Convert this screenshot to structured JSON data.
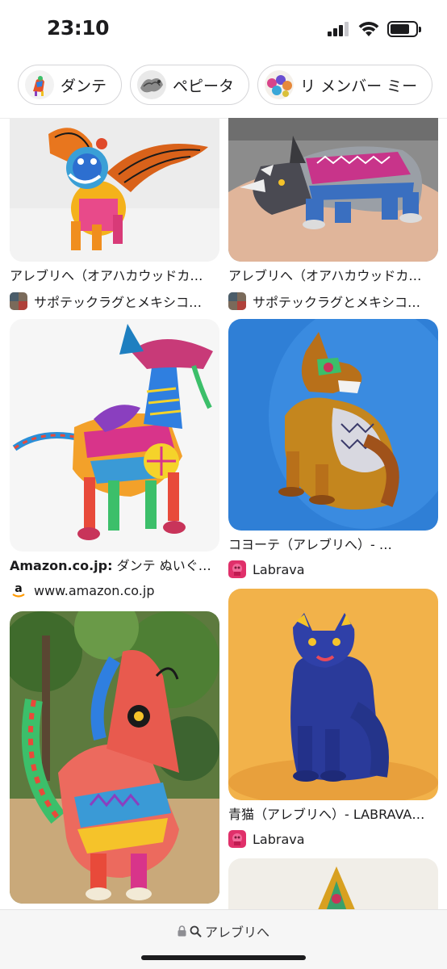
{
  "status": {
    "time": "23:10",
    "battery_level": 0.75
  },
  "chips": [
    {
      "label": "ダンテ",
      "thumb_icon": "dante-alebrije-thumb"
    },
    {
      "label": "ペピータ",
      "thumb_icon": "pepita-alebrije-thumb"
    },
    {
      "label": "リ メンバー ミー",
      "thumb_icon": "remember-me-thumb"
    }
  ],
  "results": {
    "left": [
      {
        "title": "アレブリへ（オアハカウッドカ…",
        "source": "サポテックラグとメキシコ…",
        "image": "winged-lion-alebrije"
      },
      {
        "title_bold": "Amazon.co.jp:",
        "title": " ダンテ ぬいぐ…",
        "source": "www.amazon.co.jp",
        "image": "dante-dog-alebrije"
      },
      {
        "title": "",
        "source": "",
        "image": "howling-coyote-alebrije"
      }
    ],
    "right": [
      {
        "title": "アレブリへ（オアハカウッドカ…",
        "source": "サポテックラグとメキシコ…",
        "image": "rhinoceros-alebrije"
      },
      {
        "title": "コヨーテ（アレブリへ）- …",
        "source": "Labrava",
        "image": "coyote-alebrije"
      },
      {
        "title": "青猫（アレブリへ）- LABRAVA…",
        "source": "Labrava",
        "image": "blue-cat-alebrije"
      },
      {
        "title": "",
        "source": "",
        "image": "partial-alebrije"
      }
    ]
  },
  "address_bar": {
    "text": "アレブリへ",
    "lock_icon": "lock-icon",
    "search_icon": "search-icon"
  },
  "colors": {
    "amazon_orange": "#ff9900",
    "labrava_pink": "#e0306a"
  }
}
